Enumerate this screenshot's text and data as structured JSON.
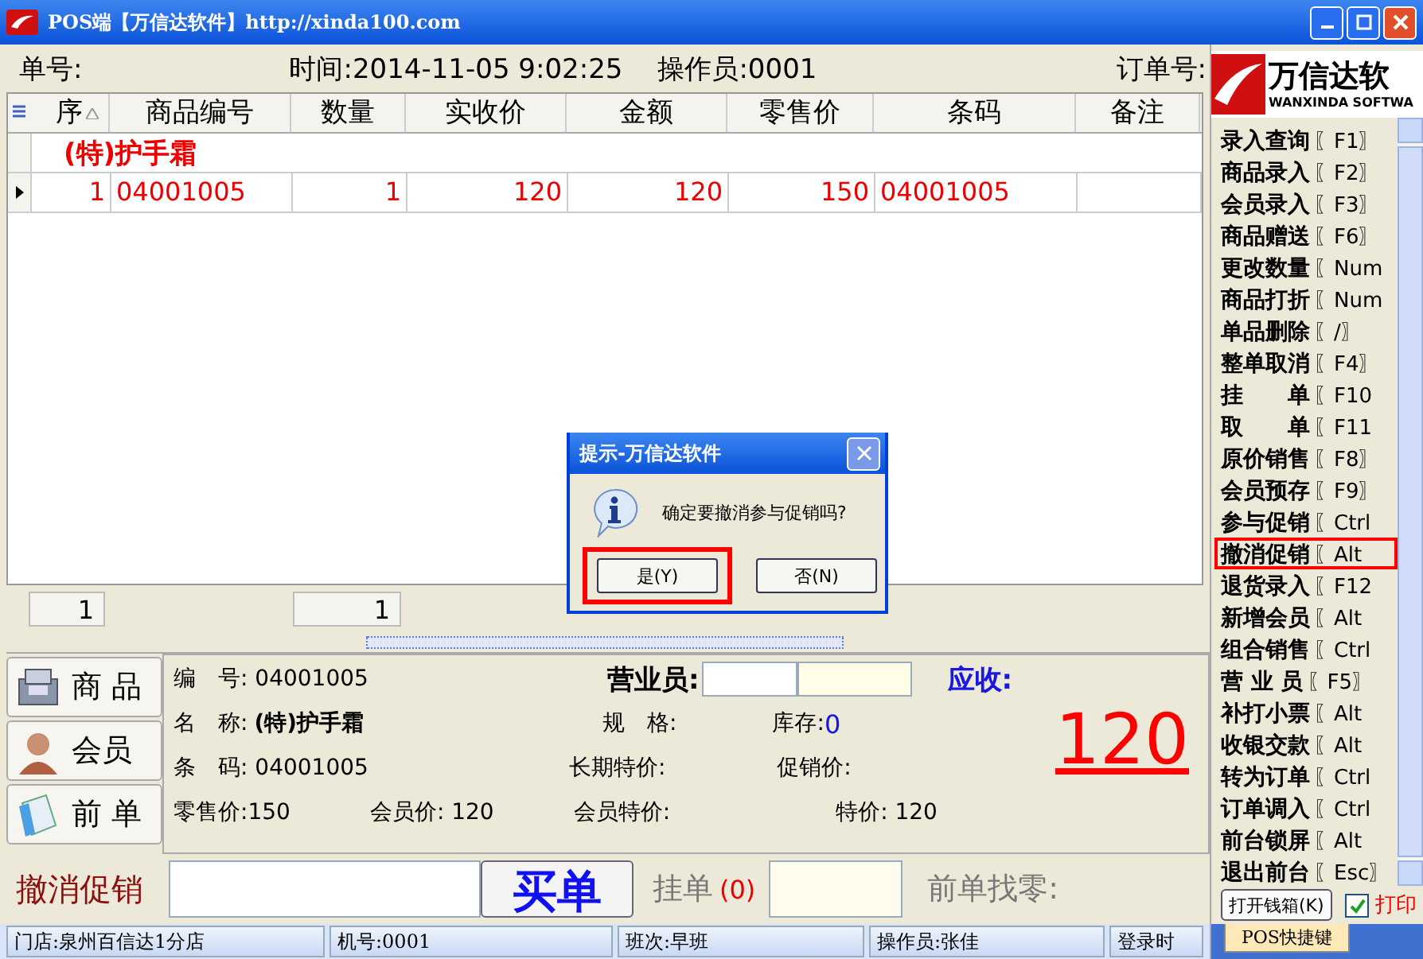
{
  "window": {
    "title": "POS端【万信达软件】http://xinda100.com"
  },
  "info_bar": {
    "order_no": "单号:",
    "time": "时间:2014-11-05 9:02:25",
    "operator": "操作员:0001",
    "order_ref": "订单号:"
  },
  "table": {
    "columns": [
      {
        "label": "序",
        "sort": true
      },
      {
        "label": "商品编号",
        "sort": false
      },
      {
        "label": "数量",
        "sort": false
      },
      {
        "label": "实收价",
        "sort": false
      },
      {
        "label": "金额",
        "sort": false
      },
      {
        "label": "零售价",
        "sort": false
      },
      {
        "label": "条码",
        "sort": false
      },
      {
        "label": "备注",
        "sort": false
      }
    ],
    "group": "(特)护手霜",
    "rows": [
      {
        "selected": true,
        "cells": [
          "1",
          "04001005",
          "1",
          "120",
          "120",
          "150",
          "04001005",
          ""
        ]
      }
    ],
    "totals": [
      "1",
      "1"
    ]
  },
  "nav": [
    {
      "kind": "goods",
      "label": "商 品"
    },
    {
      "kind": "member",
      "label": "会员"
    },
    {
      "kind": "order",
      "label": "前 单"
    }
  ],
  "details": {
    "code": "编　号: 04001005",
    "name_label": "名　称:",
    "name": "(特)护手霜",
    "barcode": "条　码: 04001005",
    "retail": "零售价:150",
    "member_price": "会员价: 120",
    "member_special": "会员特价:",
    "special": "特价: 120",
    "clerk": "营业员:",
    "spec": "规　格:",
    "stock_label": "库存:",
    "stock": "0",
    "long_special": "长期特价:",
    "promo": "促销价:",
    "due_label": "应收:",
    "due": "120"
  },
  "action_bar": {
    "mode": "撤消促销",
    "pay": "买单",
    "hold_label": "挂单",
    "hold_count": "(0)",
    "change": "前单找零:"
  },
  "status_bar": [
    "门店:泉州百信达1分店",
    "机号:0001",
    "班次:早班",
    "操作员:张佳",
    "登录时"
  ],
  "logo": {
    "name": "万信达软",
    "sub": "WANXINDA SOFTWA"
  },
  "shortcuts": [
    {
      "label": "录入查询",
      "key": "〖F1〗",
      "highlighted": false
    },
    {
      "label": "商品录入",
      "key": "〖F2〗",
      "highlighted": false
    },
    {
      "label": "会员录入",
      "key": "〖F3〗",
      "highlighted": false
    },
    {
      "label": "商品赠送",
      "key": "〖F6〗",
      "highlighted": false
    },
    {
      "label": "更改数量",
      "key": "〖Num",
      "highlighted": false
    },
    {
      "label": "商品打折",
      "key": "〖Num",
      "highlighted": false
    },
    {
      "label": "单品删除",
      "key": "〖/〗",
      "highlighted": false
    },
    {
      "label": "整单取消",
      "key": "〖F4〗",
      "highlighted": false
    },
    {
      "label": "挂　　单",
      "key": "〖F10",
      "highlighted": false
    },
    {
      "label": "取　　单",
      "key": "〖F11",
      "highlighted": false
    },
    {
      "label": "原价销售",
      "key": "〖F8〗",
      "highlighted": false
    },
    {
      "label": "会员预存",
      "key": "〖F9〗",
      "highlighted": false
    },
    {
      "label": "参与促销",
      "key": "〖Ctrl",
      "highlighted": false
    },
    {
      "label": "撤消促销",
      "key": "〖Alt",
      "highlighted": true
    },
    {
      "label": "退货录入",
      "key": "〖F12",
      "highlighted": false
    },
    {
      "label": "新增会员",
      "key": "〖Alt",
      "highlighted": false
    },
    {
      "label": "组合销售",
      "key": "〖Ctrl",
      "highlighted": false
    },
    {
      "label": "营 业 员",
      "key": "〖F5〗",
      "highlighted": false
    },
    {
      "label": "补打小票",
      "key": "〖Alt",
      "highlighted": false
    },
    {
      "label": "收银交款",
      "key": "〖Alt",
      "highlighted": false
    },
    {
      "label": "转为订单",
      "key": "〖Ctrl",
      "highlighted": false
    },
    {
      "label": "订单调入",
      "key": "〖Ctrl",
      "highlighted": false
    },
    {
      "label": "前台锁屏",
      "key": "〖Alt",
      "highlighted": false
    },
    {
      "label": "退出前台",
      "key": "〖Esc〗",
      "highlighted": false
    }
  ],
  "drawer_button": "打开钱箱(K)",
  "print": {
    "label": "打印",
    "checked": true
  },
  "tabs": [
    {
      "label": "POS快捷键",
      "selected": true
    }
  ],
  "dialog": {
    "title": "提示-万信达软件",
    "message": "确定要撤消参与促销吗?",
    "buttons": [
      {
        "label": "是(Y)",
        "highlighted": true
      },
      {
        "label": "否(N)",
        "highlighted": false
      }
    ]
  }
}
